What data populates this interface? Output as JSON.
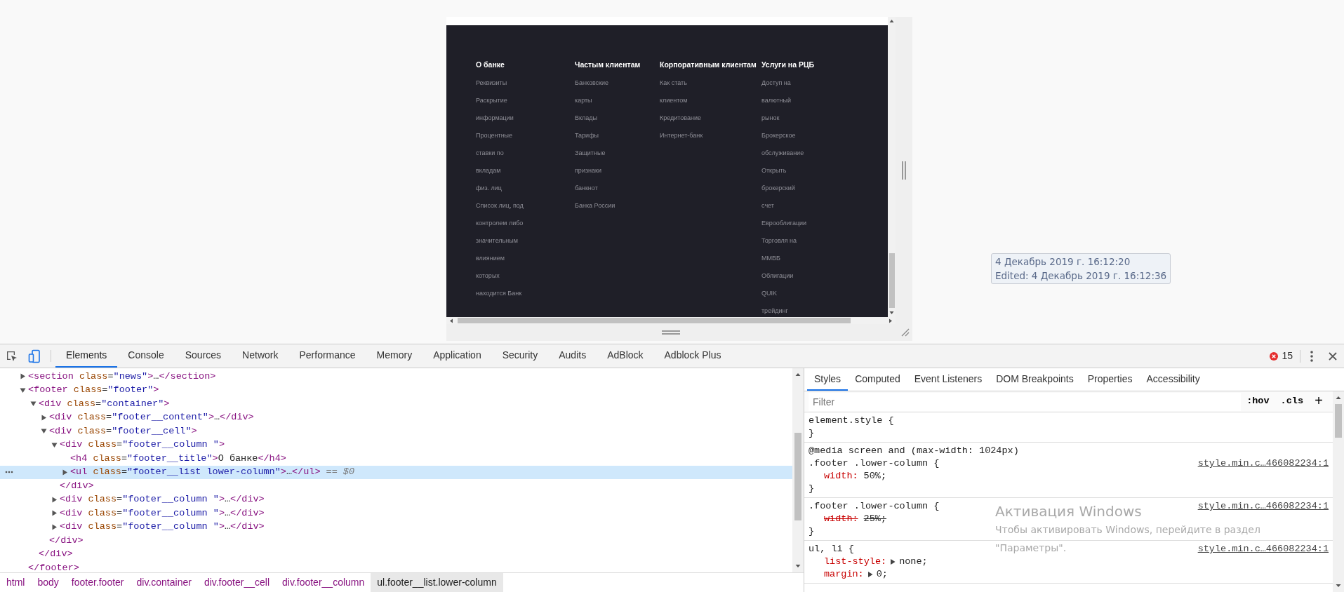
{
  "preview": {
    "columns": [
      {
        "title": "О банке",
        "items": [
          "Реквизиты",
          "Раскрытие",
          "информации",
          "Процентные",
          "ставки по",
          "вкладам",
          "физ. лиц",
          "Список лиц, под",
          "контролем либо",
          "значительным",
          "влиянием",
          "которых",
          "находится Банк"
        ]
      },
      {
        "title": "Частым клиентам",
        "items": [
          "Банковские",
          "карты",
          "Вклады",
          "Тарифы",
          "Защитные",
          "признаки",
          "банкнот",
          "Банка России"
        ]
      },
      {
        "title": "Корпоративным клиентам",
        "items": [
          "Как стать",
          "клиентом",
          "Кредитование",
          "Интернет-банк"
        ]
      },
      {
        "title": "Услуги на РЦБ",
        "items": [
          "Доступ на",
          "валютный",
          "рынок",
          "Брокерское",
          "обслуживание",
          "Открыть",
          "брокерский",
          "счет",
          "Еврооблигации",
          "Торговля на",
          "ММВБ",
          "Облигации",
          "QUIK",
          "трейдинг"
        ]
      }
    ]
  },
  "timestamp": {
    "created": "4 Декабрь 2019 г. 16:12:20",
    "edited": "Edited: 4 Декабрь 2019 г. 16:12:36"
  },
  "devtools": {
    "tabs": [
      {
        "label": "Elements",
        "selected": true
      },
      {
        "label": "Console",
        "selected": false
      },
      {
        "label": "Sources",
        "selected": false
      },
      {
        "label": "Network",
        "selected": false
      },
      {
        "label": "Performance",
        "selected": false
      },
      {
        "label": "Memory",
        "selected": false
      },
      {
        "label": "Application",
        "selected": false
      },
      {
        "label": "Security",
        "selected": false
      },
      {
        "label": "Audits",
        "selected": false
      },
      {
        "label": "AdBlock",
        "selected": false
      },
      {
        "label": "Adblock Plus",
        "selected": false
      }
    ],
    "error_count": "15",
    "dom_tree": [
      {
        "line": "<section class=\"news\">…</section>",
        "expanded": false,
        "selected": false
      },
      {
        "line": "<footer class=\"footer\">",
        "expanded": true,
        "selected": false,
        "close": "</footer>",
        "children": [
          {
            "line": "<div class=\"container\">",
            "expanded": true,
            "selected": false,
            "close": "</div>",
            "children": [
              {
                "line": "<div class=\"footer__content\">…</div>",
                "expanded": false,
                "selected": false
              },
              {
                "line": "<div class=\"footer__cell\">",
                "expanded": true,
                "selected": false,
                "close": "</div>",
                "children": [
                  {
                    "line": "<div class=\"footer__column \">",
                    "expanded": true,
                    "selected": false,
                    "close": "</div>",
                    "children": [
                      {
                        "line": "<h4 class=\"footer__title\">О банке</h4>",
                        "selected": false
                      },
                      {
                        "line": "<ul class=\"footer__list lower-column\">…</ul>",
                        "expanded": false,
                        "selected": true,
                        "marker": "== $0"
                      }
                    ]
                  },
                  {
                    "line": "<div class=\"footer__column \">…</div>",
                    "expanded": false,
                    "selected": false
                  },
                  {
                    "line": "<div class=\"footer__column \">…</div>",
                    "expanded": false,
                    "selected": false
                  },
                  {
                    "line": "<div class=\"footer__column \">…</div>",
                    "expanded": false,
                    "selected": false
                  }
                ]
              }
            ]
          }
        ]
      }
    ],
    "breadcrumbs": [
      {
        "label": "html",
        "selected": false
      },
      {
        "label": "body",
        "selected": false
      },
      {
        "label": "footer.footer",
        "selected": false
      },
      {
        "label": "div.container",
        "selected": false
      },
      {
        "label": "div.footer__cell",
        "selected": false
      },
      {
        "label": "div.footer__column",
        "selected": false
      },
      {
        "label": "ul.footer__list.lower-column",
        "selected": true
      }
    ],
    "sidebar_tabs": [
      {
        "label": "Styles",
        "selected": true
      },
      {
        "label": "Computed",
        "selected": false
      },
      {
        "label": "Event Listeners",
        "selected": false
      },
      {
        "label": "DOM Breakpoints",
        "selected": false
      },
      {
        "label": "Properties",
        "selected": false
      },
      {
        "label": "Accessibility",
        "selected": false
      }
    ],
    "filter": {
      "placeholder": "Filter"
    },
    "filter_buttons": [
      ":hov",
      ".cls",
      "+"
    ],
    "rules": [
      {
        "selector": "element.style {",
        "close": "}"
      },
      {
        "media": "@media screen and (max-width: 1024px)",
        "selector": ".footer .lower-column {",
        "source": "style.min.c…466082234:1",
        "declarations": [
          {
            "property": "width:",
            "value": "50%;",
            "overridden": false
          }
        ],
        "close": "}"
      },
      {
        "selector": ".footer .lower-column {",
        "source": "style.min.c…466082234:1",
        "declarations": [
          {
            "property": "width:",
            "value": "25%;",
            "overridden": true
          }
        ],
        "close": "}"
      },
      {
        "selector": "ul, li {",
        "source": "style.min.c…466082234:1",
        "declarations": [
          {
            "property": "list-style:",
            "value": "none;",
            "overridden": false,
            "expandable": true
          },
          {
            "property": "margin:",
            "value": "0;",
            "overridden": false,
            "expandable": true
          }
        ]
      }
    ]
  },
  "os_watermark": {
    "title": "Активация Windows",
    "lines": [
      "Чтобы активировать Windows, перейдите в раздел",
      "\"Параметры\"."
    ]
  }
}
